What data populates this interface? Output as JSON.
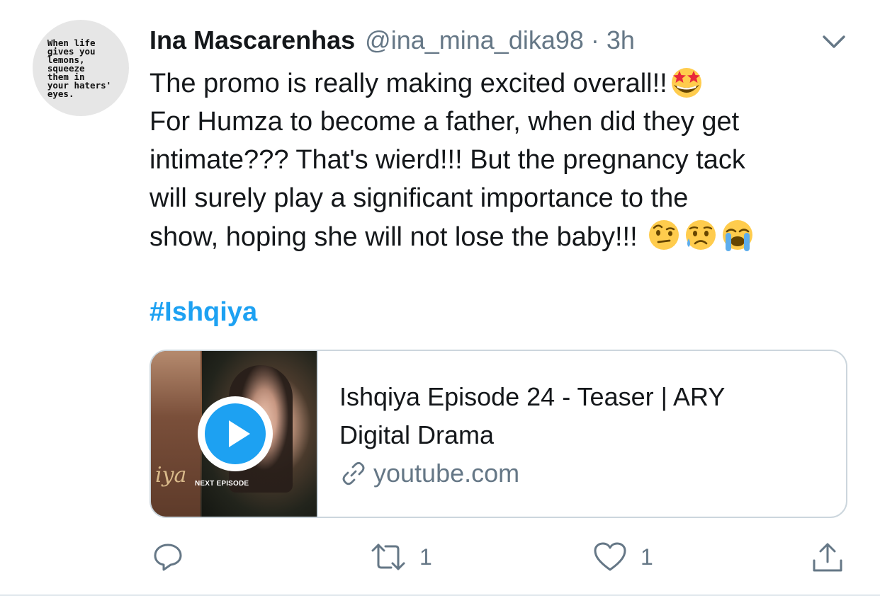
{
  "avatar": {
    "text": "When life\ngives you\nlemons,\nsqueeze\nthem in\nyour haters'\neyes."
  },
  "tweet": {
    "display_name": "Ina Mascarenhas",
    "handle": "@ina_mina_dika98",
    "separator": "·",
    "time": "3h",
    "lines": [
      "The promo is really making excited overall!!",
      "For Humza to become a father, when did they get",
      "intimate??? That's wierd!!! But the pregnancy tack",
      "will surely play a significant importance to the",
      "show, hoping she will not lose the baby!!! "
    ],
    "hashtag": "#Ishqiya",
    "emojis": [
      "star-struck",
      "face-with-raised-eyebrow",
      "sad-but-relieved-face",
      "loudly-crying-face"
    ]
  },
  "card": {
    "title_line1": "Ishqiya Episode 24 - Teaser | ARY",
    "title_line2": "Digital Drama",
    "domain": "youtube.com",
    "thumbnail_brand": "iya",
    "thumbnail_caption": "NEXT EPISODE"
  },
  "actions": {
    "reply_count": "",
    "retweet_count": "1",
    "like_count": "1"
  },
  "colors": {
    "accent": "#1da1f2",
    "secondary_text": "#657786",
    "border": "#ccd6dd"
  }
}
